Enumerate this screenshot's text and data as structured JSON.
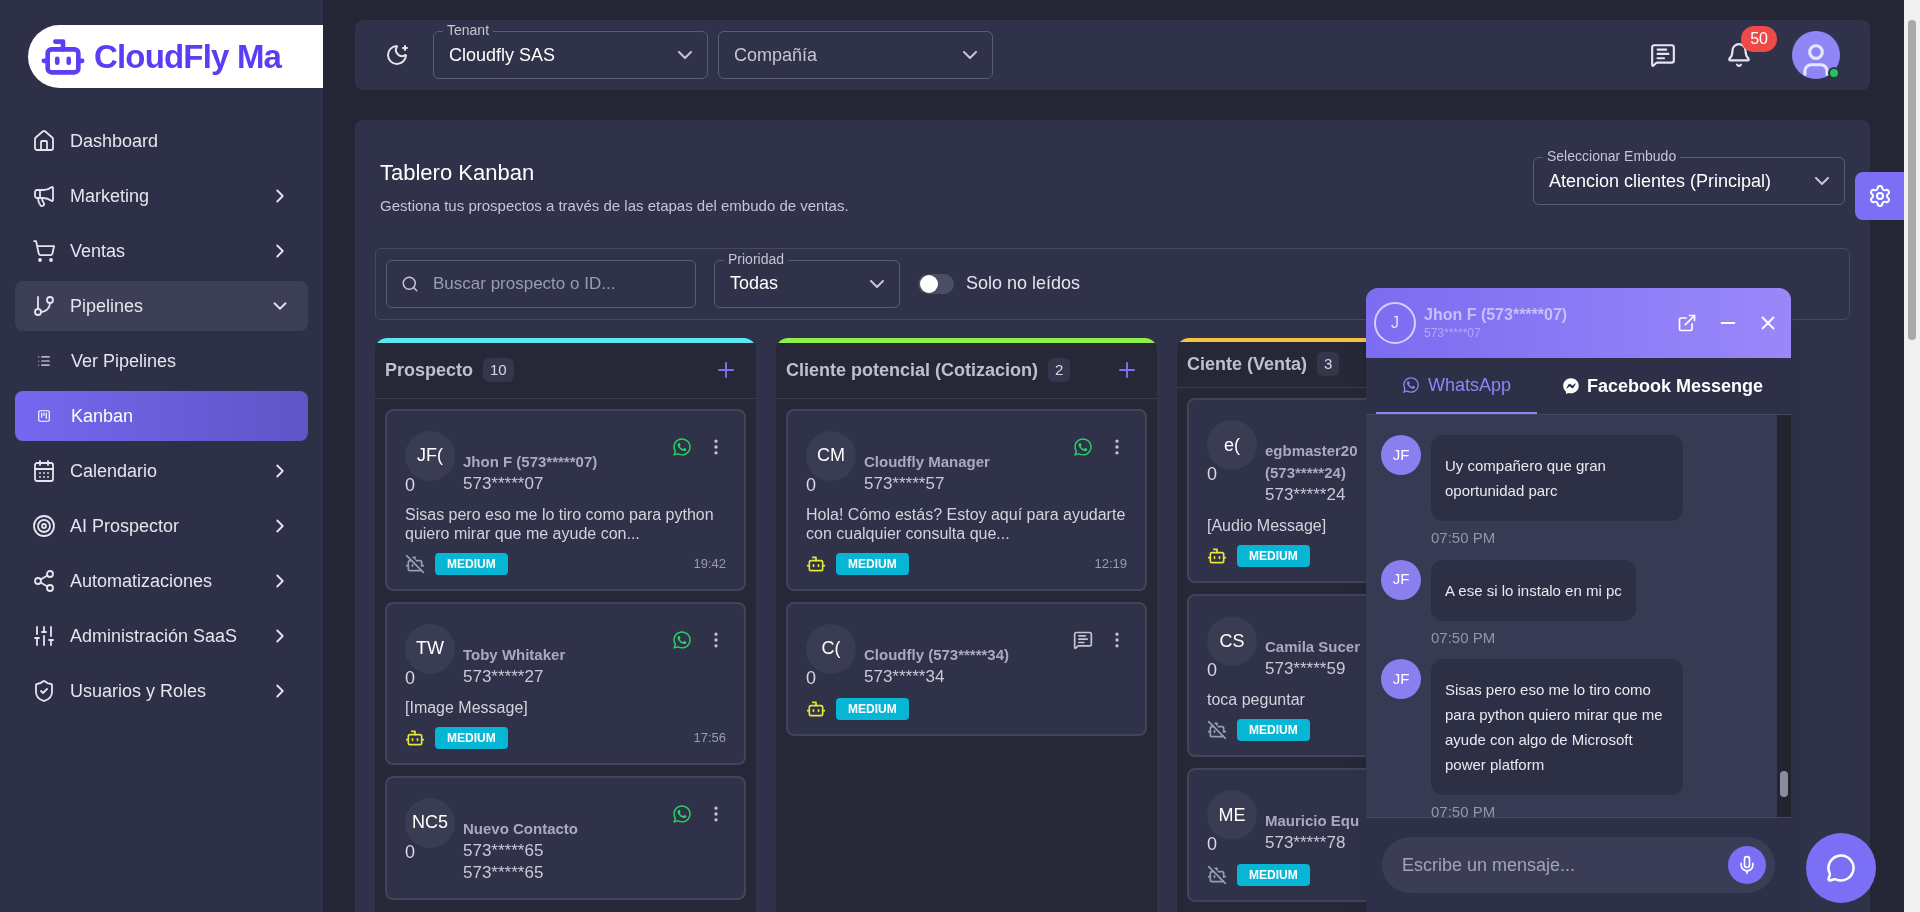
{
  "logo": {
    "text": "CloudFly Ma"
  },
  "sidebar": {
    "items": [
      {
        "label": "Dashboard",
        "has_submenu": false,
        "expanded": false,
        "selected": false
      },
      {
        "label": "Marketing",
        "has_submenu": true,
        "expanded": false,
        "selected": false
      },
      {
        "label": "Ventas",
        "has_submenu": true,
        "expanded": false,
        "selected": false
      },
      {
        "label": "Pipelines",
        "has_submenu": true,
        "expanded": true,
        "selected": false,
        "children": [
          {
            "label": "Ver Pipelines",
            "selected": false
          },
          {
            "label": "Kanban",
            "selected": true
          }
        ]
      },
      {
        "label": "Calendario",
        "has_submenu": true,
        "expanded": false,
        "selected": false
      },
      {
        "label": "AI Prospector",
        "has_submenu": true,
        "expanded": false,
        "selected": false
      },
      {
        "label": "Automatizaciones",
        "has_submenu": true,
        "expanded": false,
        "selected": false
      },
      {
        "label": "Administración SaaS",
        "has_submenu": true,
        "expanded": false,
        "selected": false
      },
      {
        "label": "Usuarios y Roles",
        "has_submenu": true,
        "expanded": false,
        "selected": false
      }
    ]
  },
  "header": {
    "tenant": {
      "label": "Tenant",
      "value": "Cloudfly SAS"
    },
    "company": {
      "placeholder": "Compañía"
    },
    "notifications": {
      "count": "50"
    },
    "user": {
      "online": true
    }
  },
  "board": {
    "title": "Tablero Kanban",
    "subtitle": "Gestiona tus prospectos a través de las etapas del embudo de ventas.",
    "funnel": {
      "label": "Seleccionar Embudo",
      "value": "Atencion clientes (Principal)"
    },
    "search": {
      "placeholder": "Buscar prospecto o ID..."
    },
    "priority": {
      "label": "Prioridad",
      "value": "Todas"
    },
    "unread_only": {
      "label": "Solo no leídos",
      "on": false
    },
    "columns": [
      {
        "title": "Prospecto",
        "count": "10",
        "color": "#5ee7f0",
        "add_button": true,
        "cards": [
          {
            "initials": "JF(",
            "score": "0",
            "name": "Jhon F (573*****07)",
            "phone": "573*****07",
            "preview": "Sisas pero eso me lo tiro como para python quiero mirar que me ayude con...",
            "whatsapp": true,
            "bot": false,
            "priority": "MEDIUM",
            "time": "19:42"
          },
          {
            "initials": "TW",
            "score": "0",
            "name": "Toby Whitaker",
            "phone": "573*****27",
            "preview": "[Image Message]",
            "whatsapp": true,
            "bot": true,
            "priority": "MEDIUM",
            "time": "17:56"
          },
          {
            "initials": "NC5",
            "score": "0",
            "name": "Nuevo Contacto",
            "phone": "573*****65",
            "phone_2": "573*****65",
            "whatsapp": true
          }
        ]
      },
      {
        "title": "Cliente potencial (Cotizacion)",
        "count": "2",
        "color": "#8ef04a",
        "add_button": true,
        "cards": [
          {
            "initials": "CM",
            "score": "0",
            "name": "Cloudfly Manager",
            "phone": "573*****57",
            "preview": "Hola! Cómo estás? Estoy aquí para ayudarte con cualquier consulta que...",
            "whatsapp": true,
            "bot": true,
            "priority": "MEDIUM",
            "time": "12:19"
          },
          {
            "initials": "C(",
            "score": "0",
            "name": "Cloudfly (573*****34)",
            "phone": "573*****34",
            "whatsapp": false,
            "bot": true,
            "priority": "MEDIUM"
          }
        ]
      },
      {
        "title": "Ciente (Venta)",
        "count": "3",
        "color": "#f6c343",
        "add_button": false,
        "cards": [
          {
            "initials": "e(",
            "score": "0",
            "name": "egbmaster20 (573*****24)",
            "phone": "573*****24",
            "preview": "[Audio Message]",
            "bot": true,
            "priority": "MEDIUM"
          },
          {
            "initials": "CS",
            "score": "0",
            "name": "Camila Sucer",
            "phone": "573*****59",
            "preview": "toca peguntar",
            "bot": false,
            "priority": "MEDIUM"
          },
          {
            "initials": "ME",
            "score": "0",
            "name": "Mauricio Equ",
            "phone": "573*****78",
            "bot": false,
            "priority": "MEDIUM"
          }
        ]
      }
    ]
  },
  "chat": {
    "contact": {
      "initial": "J",
      "name": "Jhon F (573*****07)",
      "phone": "573*****07"
    },
    "tabs": [
      {
        "label": "WhatsApp",
        "selected": true
      },
      {
        "label": "Facebook Messenge",
        "selected": false
      }
    ],
    "messages": [
      {
        "initials": "JF",
        "text": "Uy compañero que gran oportunidad parc",
        "time": "07:50 PM"
      },
      {
        "initials": "JF",
        "text": "A ese si lo instalo en mi pc",
        "time": "07:50 PM"
      },
      {
        "initials": "JF",
        "text": "Sisas pero eso me lo tiro como para python quiero mirar que me ayude con algo de Microsoft power platform",
        "time": "07:50 PM"
      }
    ],
    "composer": {
      "placeholder": "Escribe un mensaje..."
    }
  }
}
